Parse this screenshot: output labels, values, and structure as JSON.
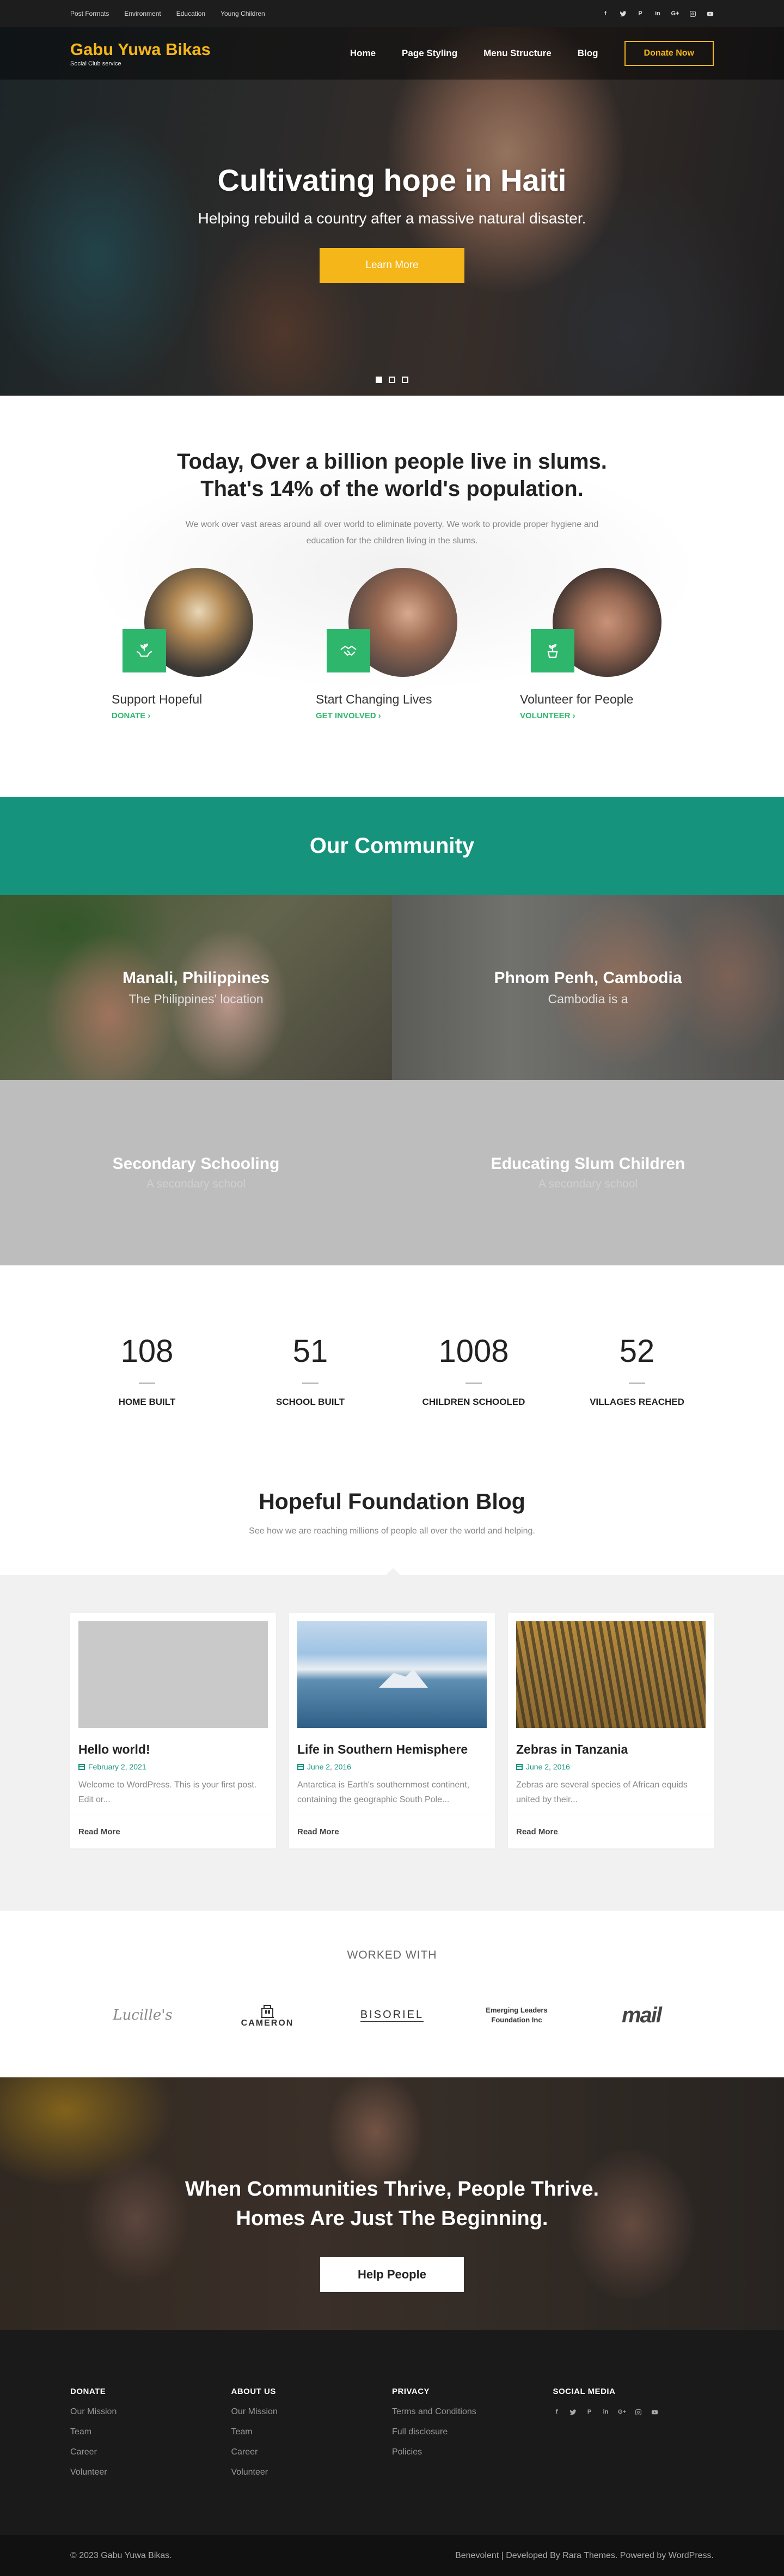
{
  "topbar": {
    "links": [
      "Post Formats",
      "Environment",
      "Education",
      "Young Children"
    ],
    "social_icons": [
      "facebook-icon",
      "twitter-icon",
      "pinterest-icon",
      "linkedin-icon",
      "google-plus-icon",
      "instagram-icon",
      "youtube-icon"
    ]
  },
  "header": {
    "brand_title": "Gabu Yuwa Bikas",
    "brand_tagline": "Social Club service",
    "nav": [
      "Home",
      "Page Styling",
      "Menu Structure",
      "Blog"
    ],
    "donate_label": "Donate Now",
    "accent_color": "#f5b61a"
  },
  "hero": {
    "title": "Cultivating hope in Haiti",
    "subtitle": "Helping rebuild a country after a massive natural disaster.",
    "button_label": "Learn More",
    "slides": 3,
    "active_slide": 1
  },
  "intro": {
    "heading_line1": "Today, Over a billion people live in slums.",
    "heading_line2": "That's 14% of the world's population.",
    "lead": "We work over vast areas around all over world to eliminate poverty. We work to provide proper hygiene and education for the children living in the slums.",
    "features": [
      {
        "title": "Support Hopeful",
        "cta": "DONATE",
        "icon": "hands-plant-icon"
      },
      {
        "title": "Start Changing Lives",
        "cta": "GET INVOLVED",
        "icon": "handshake-icon"
      },
      {
        "title": "Volunteer for People",
        "cta": "VOLUNTEER",
        "icon": "plant-pot-icon"
      }
    ],
    "green_color": "#2eb66c"
  },
  "community": {
    "heading": "Our Community",
    "bg_color": "#15937c",
    "tiles": [
      {
        "title": "Manali, Philippines",
        "text": "The Philippines' location"
      },
      {
        "title": "Phnom Penh, Cambodia",
        "text": "Cambodia is a"
      },
      {
        "title": "Secondary Schooling",
        "text": "A secondary school"
      },
      {
        "title": "Educating Slum Children",
        "text": "A secondary school"
      }
    ]
  },
  "stats": [
    {
      "value": "108",
      "label": "HOME BUILT"
    },
    {
      "value": "51",
      "label": "SCHOOL BUILT"
    },
    {
      "value": "1008",
      "label": "CHILDREN SCHOOLED"
    },
    {
      "value": "52",
      "label": "VILLAGES REACHED"
    }
  ],
  "blog": {
    "heading": "Hopeful Foundation Blog",
    "subheading": "See how we are reaching millions of people all over the world and helping.",
    "posts": [
      {
        "title": "Hello world!",
        "date": "February 2, 2021",
        "excerpt": "Welcome to WordPress. This is your first post. Edit or...",
        "more": "Read More"
      },
      {
        "title": "Life in Southern Hemisphere",
        "date": "June 2, 2016",
        "excerpt": "Antarctica is Earth's southernmost continent, containing the geographic South Pole...",
        "more": "Read More"
      },
      {
        "title": "Zebras in Tanzania",
        "date": "June 2, 2016",
        "excerpt": "Zebras are several species of African equids united by their...",
        "more": "Read More"
      }
    ]
  },
  "partners": {
    "heading": "WORKED WITH",
    "logos": [
      "Lucille's",
      "CAMERON",
      "BISORIEL",
      "Emerging Leaders Foundation Inc",
      "mail"
    ]
  },
  "cta": {
    "line1": "When Communities Thrive, People Thrive.",
    "line2": "Homes Are Just The Beginning.",
    "button_label": "Help People"
  },
  "footer": {
    "columns": [
      {
        "title": "DONATE",
        "items": [
          "Our Mission",
          "Team",
          "Career",
          "Volunteer"
        ]
      },
      {
        "title": "ABOUT US",
        "items": [
          "Our Mission",
          "Team",
          "Career",
          "Volunteer"
        ]
      },
      {
        "title": "PRIVACY",
        "items": [
          "Terms and Conditions",
          "Full disclosure",
          "Policies"
        ]
      }
    ],
    "social_title": "SOCIAL MEDIA",
    "copyright": "© 2023 Gabu Yuwa Bikas.",
    "credits": "Benevolent | Developed By Rara Themes. Powered by WordPress."
  }
}
